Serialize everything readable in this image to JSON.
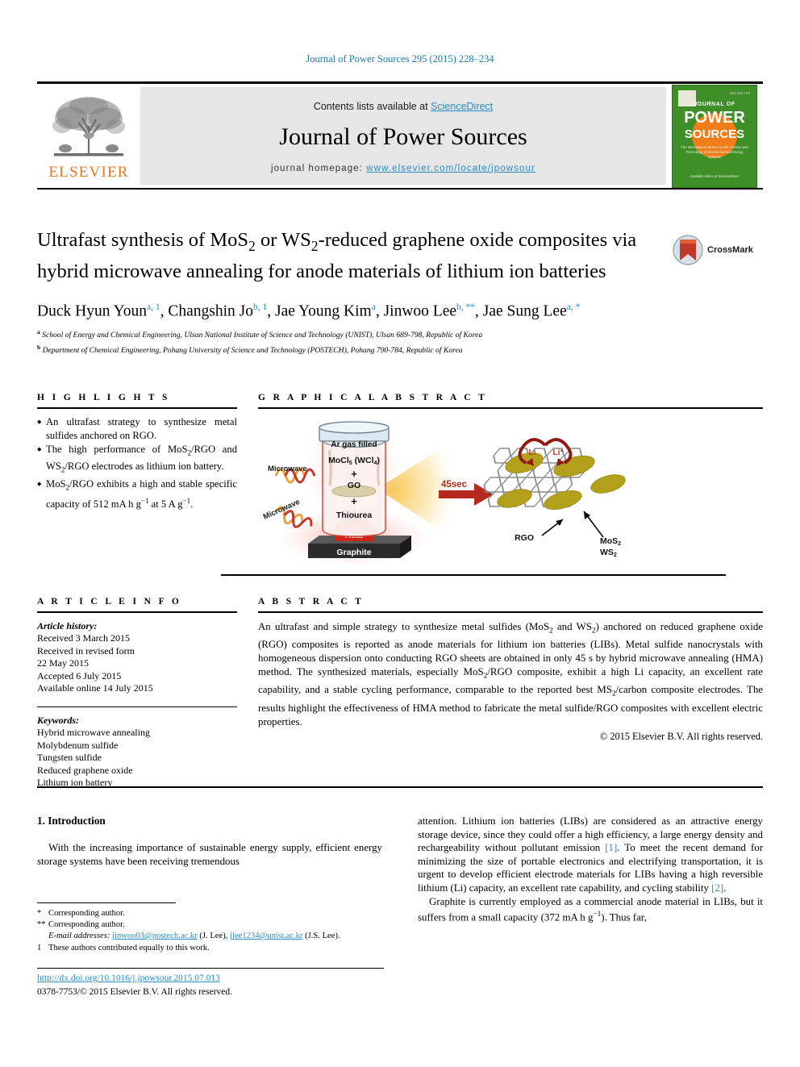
{
  "running_head": "Journal of Power Sources 295 (2015) 228–234",
  "masthead": {
    "contents_prefix": "Contents lists available at ",
    "sciencedirect": "ScienceDirect",
    "journal_name": "Journal of Power Sources",
    "homepage_prefix": "journal homepage: ",
    "homepage_url": "www.elsevier.com/locate/jpowsour",
    "publisher_wordmark": "ELSEVIER",
    "publisher_color": "#e87722",
    "cover": {
      "journal_of": "JOURNAL OF",
      "power": "POWER",
      "sources": "SOURCES",
      "subtitle": "The International Journal on the Science and Technology of Electrochemical Energy Systems",
      "footer": "Available online at\nScienceDirect",
      "top_tiny": "ISSN 0378-7753",
      "background_color": "#3f8f29",
      "sun_color": "#f07d1a"
    }
  },
  "article": {
    "title_line1": "Ultrafast synthesis of MoS",
    "title_sub1": "2",
    "title_line1b": " or WS",
    "title_sub2": "2",
    "title_line1c": "-reduced graphene oxide",
    "title_line2": "composites via hybrid microwave annealing for anode materials of",
    "title_line3": "lithium ion batteries",
    "title_plain": "Ultrafast synthesis of MoS2 or WS2-reduced graphene oxide composites via hybrid microwave annealing for anode materials of lithium ion batteries",
    "crossmark_label": "CrossMark",
    "authors": [
      {
        "name": "Duck Hyun Youn",
        "marks": "a, 1"
      },
      {
        "name": "Changshin Jo",
        "marks": "b, 1"
      },
      {
        "name": "Jae Young Kim",
        "marks": "a"
      },
      {
        "name": "Jinwoo Lee",
        "marks": "b, **"
      },
      {
        "name": "Jae Sung Lee",
        "marks": "a, *"
      }
    ],
    "affiliations": [
      {
        "mark": "a",
        "text": "School of Energy and Chemical Engineering, Ulsan National Institute of Science and Technology (UNIST), Ulsan 689-798, Republic of Korea"
      },
      {
        "mark": "b",
        "text": "Department of Chemical Engineering, Pohang University of Science and Technology (POSTECH), Pohang 790-784, Republic of Korea"
      }
    ]
  },
  "highlights": {
    "heading": "H I G H L I G H T S",
    "items": [
      "An ultrafast strategy to synthesize metal sulfides anchored on RGO.",
      "The high performance of MoS2/RGO and WS2/RGO electrodes as lithium ion battery.",
      "MoS2/RGO exhibits a high and stable specific capacity of 512 mA h g−1 at 5 A g−1."
    ]
  },
  "graphical_abstract": {
    "heading": "G R A P H I C A L   A B S T R A C T",
    "labels": {
      "ar_gas": "Ar gas filled",
      "precursor": "MoCl5 (WCl4)",
      "go": "GO",
      "thiourea": "Thiourea",
      "plus1": "+",
      "plus2": "+",
      "microwave1": "Microwave",
      "microwave2": "Microwave",
      "heat": "Heat",
      "graphite": "Graphite",
      "time": "45sec",
      "li": "Li",
      "li_ion": "Li⁺",
      "rgo": "RGO",
      "mos2": "MoS2",
      "ws2": "WS2"
    },
    "colors": {
      "arrow": "#b5291f",
      "sulfide": "#b3a11c",
      "carbon": "#8c8c8c",
      "heat_block": "#cf2418"
    }
  },
  "article_info": {
    "heading": "A R T I C L E   I N F O",
    "history_title": "Article history:",
    "history_lines": [
      "Received 3 March 2015",
      "Received in revised form",
      "22 May 2015",
      "Accepted 6 July 2015",
      "Available online 14 July 2015"
    ],
    "keywords_title": "Keywords:",
    "keywords": [
      "Hybrid microwave annealing",
      "Molybdenum sulfide",
      "Tungsten sulfide",
      "Reduced graphene oxide",
      "Lithium ion battery"
    ]
  },
  "abstract": {
    "heading": "A B S T R A C T",
    "text": "An ultrafast and simple strategy to synthesize metal sulfides (MoS2 and WS2) anchored on reduced graphene oxide (RGO) composites is reported as anode materials for lithium ion batteries (LIBs). Metal sulfide nanocrystals with homogeneous dispersion onto conducting RGO sheets are obtained in only 45 s by hybrid microwave annealing (HMA) method. The synthesized materials, especially MoS2/RGO composite, exhibit a high Li capacity, an excellent rate capability, and a stable cycling performance, comparable to the reported best MS2/carbon composite electrodes. The results highlight the effectiveness of HMA method to fabricate the metal sulfide/RGO composites with excellent electric properties.",
    "copyright": "© 2015 Elsevier B.V. All rights reserved."
  },
  "body": {
    "section_number": "1.",
    "section_title": "Introduction",
    "left_paragraph": "With the increasing importance of sustainable energy supply, efficient energy storage systems have been receiving tremendous",
    "right_paragraph_1": "attention. Lithium ion batteries (LIBs) are considered as an attractive energy storage device, since they could offer a high efficiency, a large energy density and rechargeability without pollutant emission [1]. To meet the recent demand for minimizing the size of portable electronics and electrifying transportation, it is urgent to develop efficient electrode materials for LIBs having a high reversible lithium (Li) capacity, an excellent rate capability, and cycling stability [2].",
    "right_paragraph_2": "Graphite is currently employed as a commercial anode material in LIBs, but it suffers from a small capacity (372 mA h g−1). Thus far,"
  },
  "footnotes": {
    "corresponding_1": "Corresponding author.",
    "corresponding_2": "Corresponding author.",
    "email_label": "E-mail addresses:",
    "email_1": "jinwoo03@postech.ac.kr",
    "email_1_owner": "(J. Lee)",
    "email_2": "jlee1234@unist.ac.kr",
    "email_2_owner": "(J.S. Lee).",
    "equal_contribution_mark": "1",
    "equal_contribution": "These authors contributed equally to this work."
  },
  "footer": {
    "doi": "http://dx.doi.org/10.1016/j.jpowsour.2015.07.013",
    "issn": "0378-7753/© 2015 Elsevier B.V. All rights reserved."
  }
}
